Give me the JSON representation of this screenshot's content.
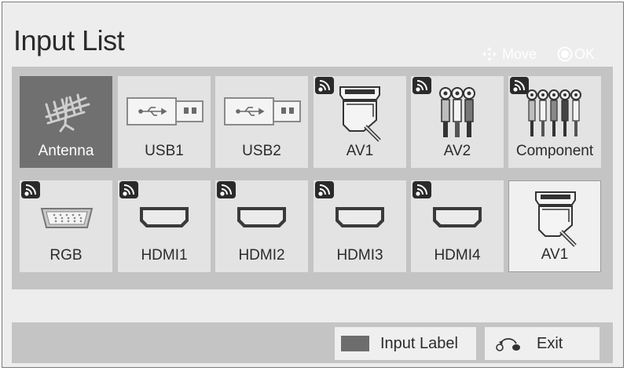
{
  "title": "Input List",
  "hints": {
    "move_label": "Move",
    "ok_label": "OK"
  },
  "inputs": [
    {
      "label": "Antenna",
      "icon": "antenna-icon"
    },
    {
      "label": "USB1",
      "icon": "usb-icon"
    },
    {
      "label": "USB2",
      "icon": "usb-icon"
    },
    {
      "label": "AV1",
      "icon": "scart-icon"
    },
    {
      "label": "AV2",
      "icon": "rca-av-icon"
    },
    {
      "label": "Component",
      "icon": "rca-component-icon"
    },
    {
      "label": "RGB",
      "icon": "vga-icon"
    },
    {
      "label": "HDMI1",
      "icon": "hdmi-icon"
    },
    {
      "label": "HDMI2",
      "icon": "hdmi-icon"
    },
    {
      "label": "HDMI3",
      "icon": "hdmi-icon"
    },
    {
      "label": "HDMI4",
      "icon": "hdmi-icon"
    },
    {
      "label": "AV1",
      "icon": "scart-icon"
    }
  ],
  "buttons": {
    "input_label": "Input Label",
    "exit": "Exit"
  },
  "colors": {
    "selected_tile": "#707070",
    "tile": "#e3e3e3",
    "panel": "#c4c4c4",
    "input_label_swatch": "#6d6d6d"
  }
}
